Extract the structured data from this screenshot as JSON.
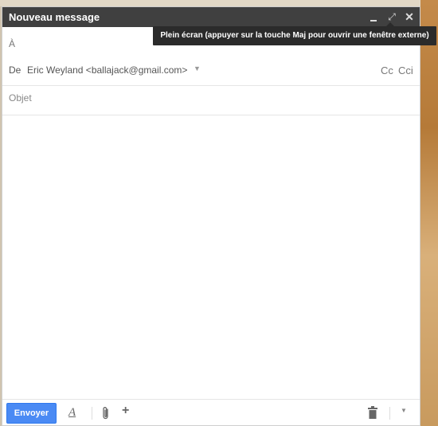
{
  "window": {
    "title": "Nouveau message",
    "close_glyph": "✕",
    "fullscreen_glyph": "⤢"
  },
  "tooltip": {
    "text": "Plein écran (appuyer sur la touche Maj pour ouvrir une fenêtre externe)"
  },
  "fields": {
    "to_label": "À",
    "from_label": "De",
    "from_value": "Eric Weyland <ballajack@gmail.com>",
    "from_caret": "▼",
    "cc_label": "Cc",
    "cci_label": "Cci",
    "subject_placeholder": "Objet",
    "subject_value": ""
  },
  "footer": {
    "send_label": "Envoyer",
    "format_glyph": "A",
    "insert_glyph": "+",
    "more_glyph": "▼"
  },
  "colors": {
    "titlebar": "#404040",
    "send_button": "#4a8af4"
  }
}
